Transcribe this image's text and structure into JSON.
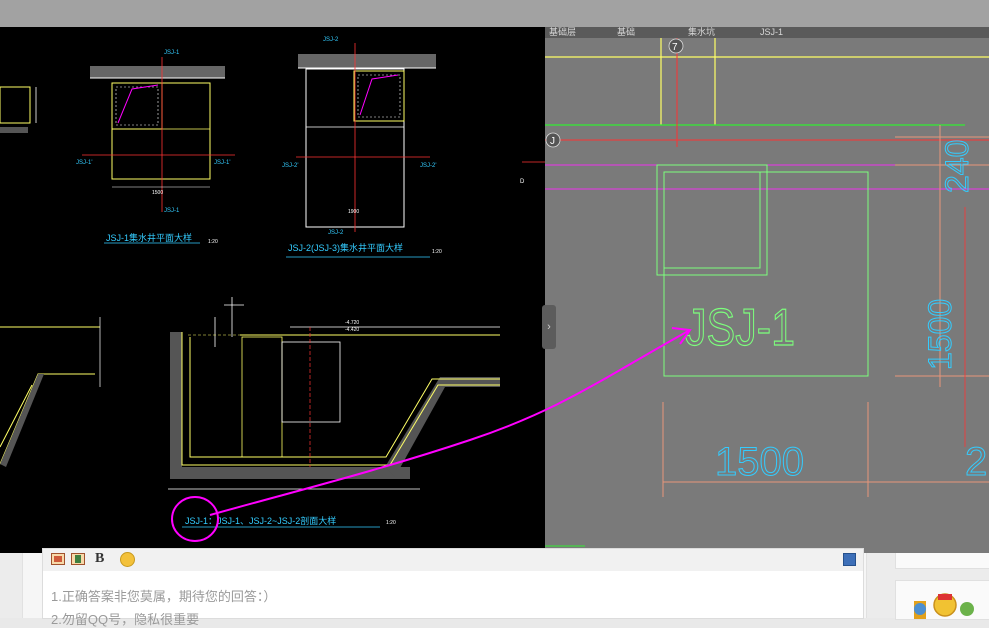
{
  "cad_left": {
    "plan1_title": "JSJ-1集水井平面大样",
    "plan2_title": "JSJ-2(JSJ-3)集水井平面大样",
    "section_title": "JSJ-1：JSJ-1、JSJ-2~JSJ-2剖面大样",
    "scale_label": "1:20",
    "tag_jsj1": "JSJ-1",
    "tag_jsj1_prime": "JSJ-1'",
    "tag_jsj2": "JSJ-2",
    "tag_jsj2_prime": "JSJ-2'",
    "dim_1500": "1500",
    "dim_240": "240",
    "dim_1900": "1900",
    "elev_1": "-4.720",
    "elev_2": "-4.420",
    "side_label": "D"
  },
  "cad_right": {
    "tabs": [
      "基础层",
      "基础",
      "集水坑",
      "JSJ-1"
    ],
    "axis_7": "7",
    "axis_j": "J",
    "pit_label": "JSJ-1",
    "dim_240": "240",
    "dim_1500_v": "1500",
    "dim_1500_h": "1500",
    "dim_2": "2"
  },
  "collapse_handle": "›",
  "editor": {
    "bold_label": "B",
    "placeholder_line1": "1.正确答案非您莫属，期待您的回答：）",
    "placeholder_line2": "2.勿留QQ号，隐私很重要"
  },
  "colors": {
    "annotation": "#ff00ff",
    "cad_yellow": "#ffff66",
    "cad_cyan": "#33ccff",
    "cad_red": "#ff3333",
    "cad_green": "#66ff66"
  }
}
